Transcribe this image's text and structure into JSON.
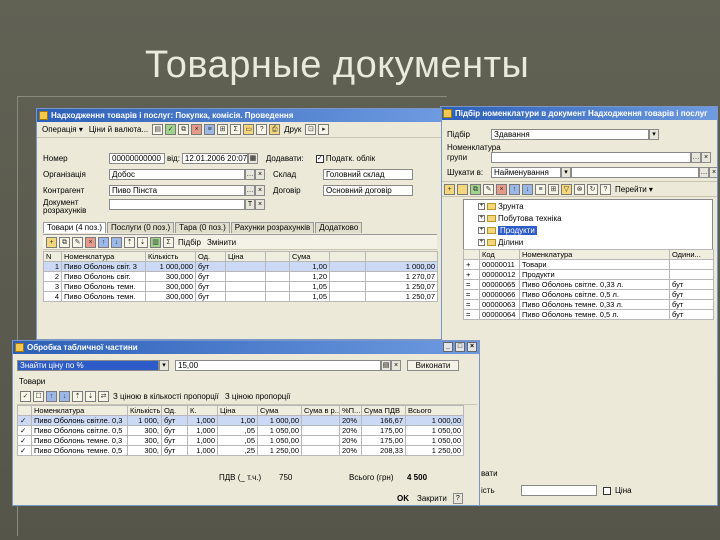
{
  "slide": {
    "title": "Товарные документы"
  },
  "main_window": {
    "title": "Надходження товарів і послуг: Покупка, комісія. Проведення",
    "toolbar": {
      "operation": "Операція ▾",
      "prices": "Ціни й валюта...",
      "print": "Друк"
    },
    "labels": {
      "number": "Номер",
      "date": "від:",
      "org": "Організація",
      "counterparty": "Контрагент",
      "document": "Документ розрахунків",
      "add_extra": "Додавати:",
      "add_tax": "Податк. облік",
      "warehouse": "Склад",
      "contract": "Договір"
    },
    "values": {
      "number": "00000000000",
      "date": "12.01.2006 20:07:07",
      "org": "Добос",
      "counterparty": "Пиво Пінста",
      "warehouse": "Головний склад",
      "contract": "Основний договір"
    },
    "tabs": [
      "Товари (4 поз.)",
      "Послуги (0 поз.)",
      "Тара (0 поз.)",
      "Рахунки розрахунків",
      "Додатково"
    ],
    "tab_toolbar": {
      "selection": "Підбір",
      "change": "Змінити"
    },
    "table": {
      "headers": [
        "N",
        "Номенклатура",
        "Кількість",
        "Од.",
        "Ціна",
        "",
        "Сума",
        "",
        ""
      ],
      "rows": [
        [
          "1",
          "Пиво Оболонь світ. 3",
          "1 000,000",
          "бут",
          "",
          "",
          "1,00",
          "",
          "1 000,00"
        ],
        [
          "2",
          "Пиво Оболонь світ.",
          "300,000",
          "бут",
          "",
          "",
          "1,20",
          "",
          "1 270,07"
        ],
        [
          "3",
          "Пиво Оболонь темн.",
          "300,000",
          "бут",
          "",
          "",
          "1,05",
          "",
          "1 250,07"
        ],
        [
          "4",
          "Пиво Оболонь темн.",
          "300,000",
          "бут",
          "",
          "",
          "1,05",
          "",
          "1 250,07"
        ]
      ]
    }
  },
  "picker_window": {
    "title": "Підбір номенклатури в документ Надходження товарів і послуг",
    "labels": {
      "selection": "Підбір",
      "nomenclature": "Номенклатура",
      "group": "групи",
      "search": "Шукати в:"
    },
    "values": {
      "selection": "Здавання",
      "search": "Найменування"
    },
    "toolbar": {
      "goto": "Перейти ▾"
    },
    "tree": [
      {
        "label": "Зрунта",
        "level": 1
      },
      {
        "label": "Побутова техніка",
        "level": 1
      },
      {
        "label": "Продукти",
        "level": 1
      },
      {
        "label": "Ділини",
        "level": 1
      }
    ],
    "list": {
      "headers": [
        "Код",
        "Номенклатура",
        "Одини..."
      ],
      "rows": [
        [
          "+",
          "00000011",
          "Товари",
          ""
        ],
        [
          "+",
          "00000012",
          "Продукти",
          ""
        ],
        [
          "=",
          "00000065",
          "Пиво Оболонь світле. 0,33 л.",
          "бут"
        ],
        [
          "=",
          "00000066",
          "Пиво Оболонь світле. 0,5 л.",
          "бут"
        ],
        [
          "=",
          "00000063",
          "Пиво Оболонь темне. 0,33 л.",
          "бут"
        ],
        [
          "=",
          "00000064",
          "Пиво Оболонь темне. 0,5 л.",
          "бут"
        ]
      ]
    },
    "bottom": {
      "tail_label": "вати",
      "tail2_label": "ість",
      "option": "Ціна"
    }
  },
  "processing_window": {
    "title": "Обробка табличної частини",
    "toolbar": {
      "mode": "Знайти ціну по %",
      "value": "15,00",
      "run": "Виконати"
    },
    "section": "Товари",
    "sub_toolbar": {
      "to_price": "З ціною в кількості пропорції",
      "by_price": "З ціною пропорції"
    },
    "table": {
      "headers": [
        "",
        "Номенклатура",
        "Кількість",
        "Од.",
        "К.",
        "Ціна",
        "Сума",
        "Сума в р...",
        "%П...",
        "Сума ПДВ",
        "Всього"
      ],
      "rows": [
        [
          "✓",
          "Пиво Оболонь світле. 0,3",
          "1 000,",
          "бут",
          "1,000",
          "1,00",
          "1 000,00",
          "",
          "20%",
          "166,67",
          "1 000,00"
        ],
        [
          "✓",
          "Пиво Оболонь світле. 0,5",
          "300,",
          "бут",
          "1,000",
          ",05",
          "1 050,00",
          "",
          "20%",
          "175,00",
          "1 050,00"
        ],
        [
          "✓",
          "Пиво Оболонь темне. 0,3",
          "300,",
          "бут",
          "1,000",
          ",05",
          "1 050,00",
          "",
          "20%",
          "175,00",
          "1 050,00"
        ],
        [
          "✓",
          "Пиво Оболонь темне. 0,5",
          "300,",
          "бут",
          "1,000",
          ",25",
          "1 250,00",
          "",
          "20%",
          "208,33",
          "1 250,00"
        ]
      ]
    },
    "footer": {
      "vat_label": "ПДВ (_ т.ч.)",
      "vat_value": "750",
      "total_label": "Всього (грн)",
      "total_value": "4 500",
      "ok": "OK",
      "close": "Закрити"
    }
  }
}
